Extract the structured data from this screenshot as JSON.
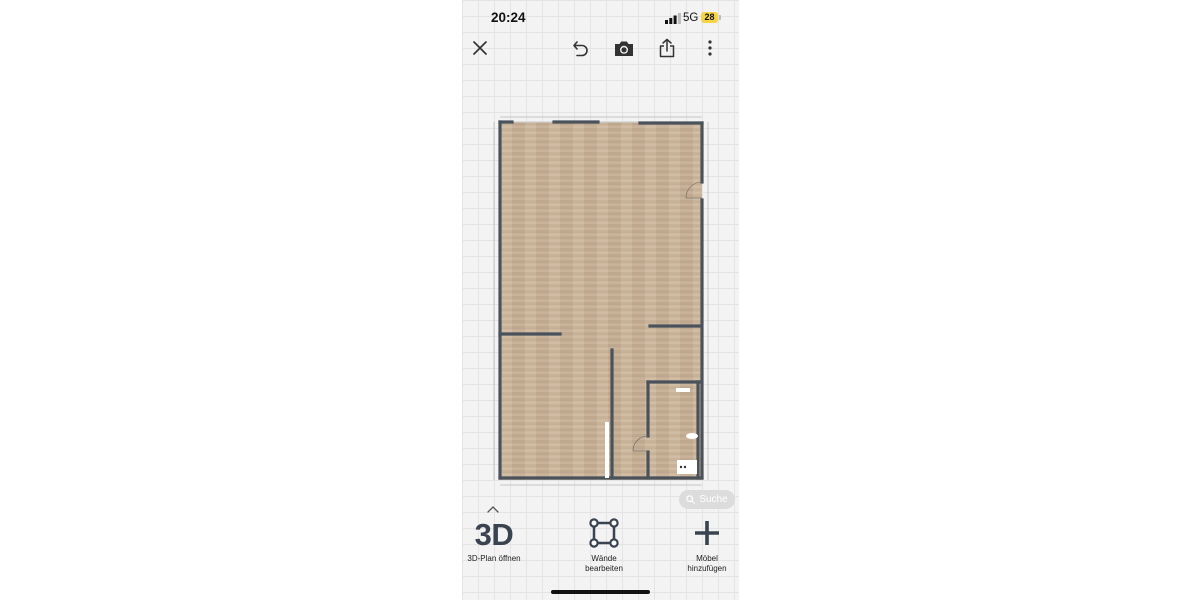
{
  "status_bar": {
    "time": "20:24",
    "network": "5G",
    "battery": "28"
  },
  "toolbar": {
    "icons": [
      "close-icon",
      "undo-icon",
      "camera-icon",
      "share-icon",
      "more-vertical-icon"
    ]
  },
  "floorplan": {
    "floor_color": "#c8b39a",
    "wall_color": "#4a525c"
  },
  "search": {
    "label": "Suche",
    "icon": "search-icon"
  },
  "bottom_actions": [
    {
      "glyph": "3D",
      "label": "3D-Plan öffnen",
      "icon": "3d-text-icon"
    },
    {
      "label_line1": "Wände",
      "label_line2": "bearbeiten",
      "icon": "edit-walls-icon"
    },
    {
      "label_line1": "Möbel",
      "label_line2": "hinzufügen",
      "icon": "plus-icon"
    }
  ]
}
